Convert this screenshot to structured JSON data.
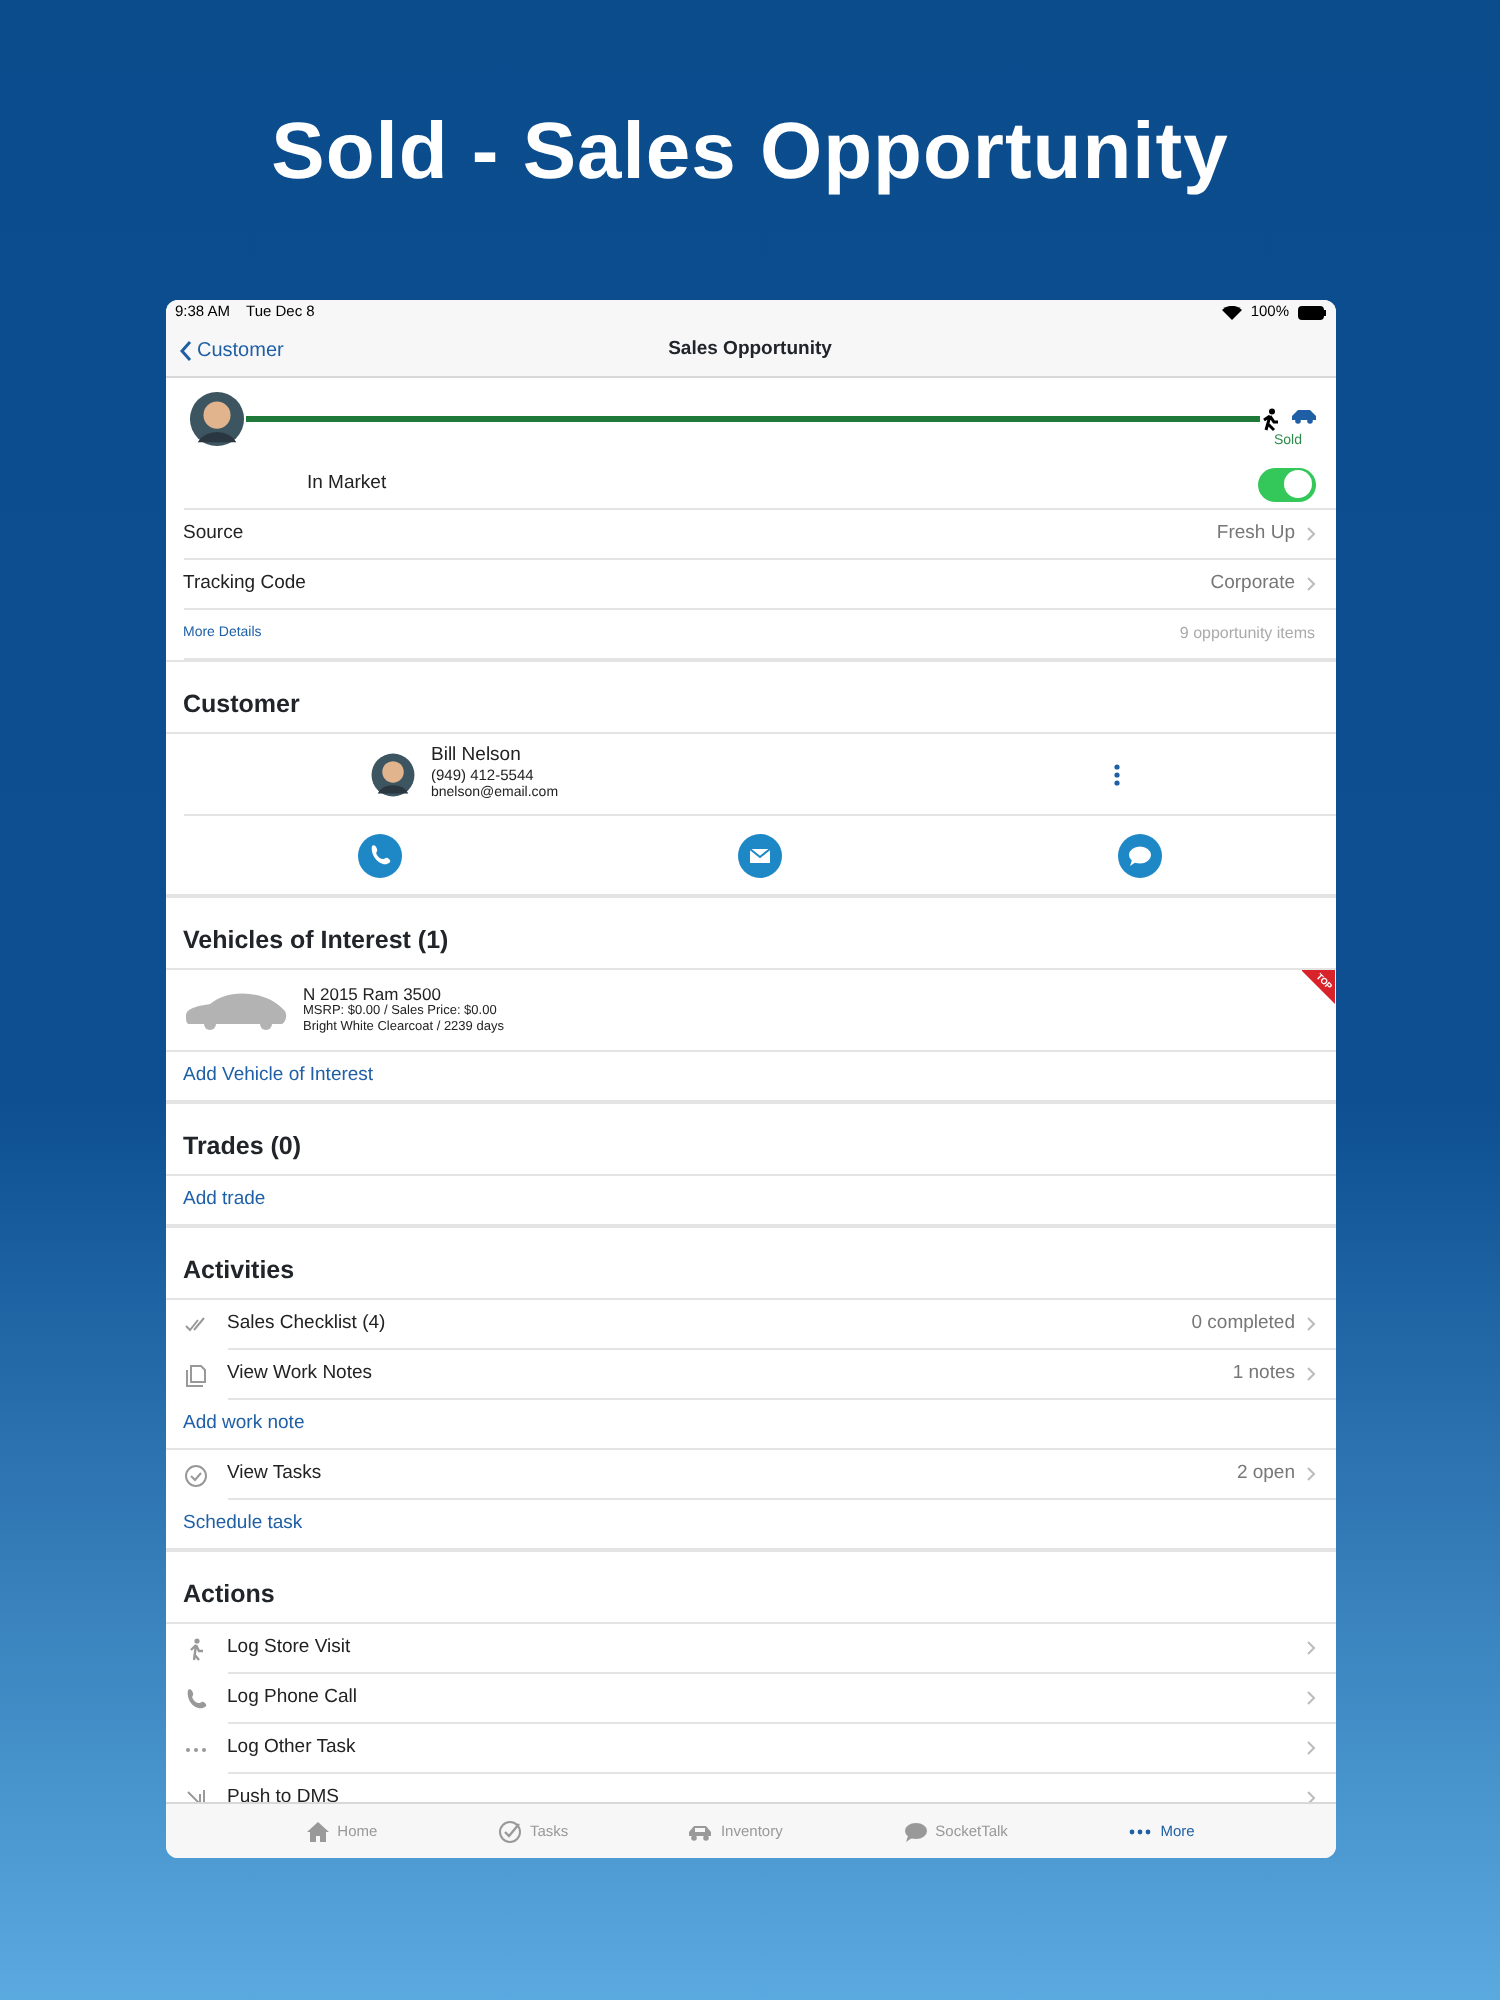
{
  "headline": "Sold - Sales Opportunity",
  "status_bar": {
    "time": "9:38 AM",
    "date": "Tue Dec 8",
    "battery": "100%"
  },
  "nav": {
    "back": "Customer",
    "title": "Sales Opportunity"
  },
  "progress": {
    "stage": "Sold",
    "level": 1
  },
  "in_market": {
    "label": "In Market",
    "on": true
  },
  "detail_rows": [
    {
      "label": "Source",
      "value": "Fresh Up"
    },
    {
      "label": "Tracking Code",
      "value": "Corporate"
    }
  ],
  "more_details": {
    "link": "More Details",
    "count": "9 opportunity items"
  },
  "customer": {
    "heading": "Customer",
    "name": "Bill Nelson",
    "phone": "(949) 412-5544",
    "email": "bnelson@email.com"
  },
  "vehicles": {
    "heading": "Vehicles of Interest (1)",
    "items": [
      {
        "title": "N 2015 Ram 3500",
        "price": "MSRP: $0.00 / Sales Price: $0.00",
        "detail": "Bright White Clearcoat / 2239 days",
        "ribbon": "TOP"
      }
    ],
    "add_link": "Add Vehicle of Interest"
  },
  "trades": {
    "heading": "Trades (0)",
    "add_link": "Add trade"
  },
  "activities": {
    "heading": "Activities",
    "rows": [
      {
        "kind": "item",
        "label": "Sales Checklist (4)",
        "value": "0 completed"
      },
      {
        "kind": "item",
        "label": "View Work Notes",
        "value": "1 notes"
      },
      {
        "kind": "link",
        "label": "Add work note"
      },
      {
        "kind": "item",
        "label": "View Tasks",
        "value": "2 open"
      },
      {
        "kind": "link",
        "label": "Schedule task"
      }
    ]
  },
  "actions": {
    "heading": "Actions",
    "rows": [
      {
        "label": "Log Store Visit"
      },
      {
        "label": "Log Phone Call"
      },
      {
        "label": "Log Other Task"
      },
      {
        "label": "Push to DMS"
      }
    ]
  },
  "tabs": [
    {
      "label": "Home",
      "selected": false
    },
    {
      "label": "Tasks",
      "selected": false
    },
    {
      "label": "Inventory",
      "selected": false
    },
    {
      "label": "SocketTalk",
      "selected": false
    },
    {
      "label": "More",
      "selected": true
    }
  ]
}
